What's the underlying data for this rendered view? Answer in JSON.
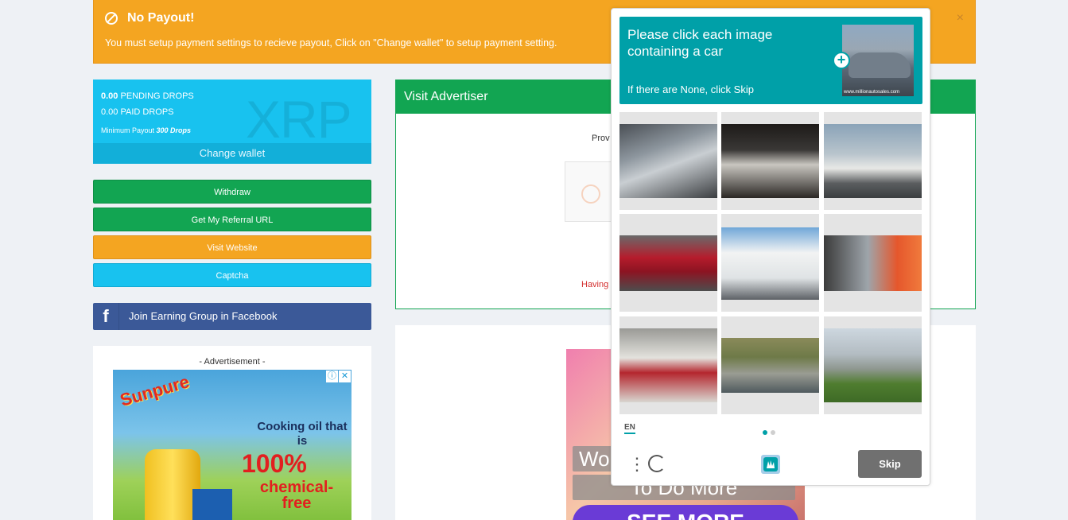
{
  "alert": {
    "title": "No Payout!",
    "message": "You must setup payment settings to recieve payout, Click on \"Change wallet\" to setup payment setting.",
    "close": "×"
  },
  "wallet": {
    "pending_value": "0.00",
    "pending_label": " PENDING DROPS",
    "paid_value": "0.00",
    "paid_label": " PAID DROPS",
    "min_label": "Minimum Payout ",
    "min_value": "300 Drops",
    "watermark": "XRP",
    "change_wallet": "Change wallet"
  },
  "sidebar": {
    "withdraw": "Withdraw",
    "referral": "Get My Referral URL",
    "visit": "Visit Website",
    "captcha": "Captcha",
    "facebook": "Join Earning Group in Facebook"
  },
  "ads": {
    "label": "- Advertisement -",
    "left": {
      "brand": "Sunpure",
      "line1": "Cooking oil that is",
      "line2": "100%",
      "line3": "chemical-free"
    },
    "right": {
      "line1": "Wo",
      "line2": "To Do More",
      "line3": "SEE MORE"
    }
  },
  "visit_panel": {
    "title": "Visit Advertiser",
    "provide": "Prov",
    "having": "Having"
  },
  "captcha": {
    "prompt": "Please click each image containing a car",
    "sub": "If there are None, click Skip",
    "example_url": "www.millionautosales.com",
    "lang": "EN",
    "skip": "Skip"
  },
  "colors": {
    "green": "#12a552",
    "orange": "#f4a521",
    "cyan": "#18c2ef",
    "facebook": "#3b5998",
    "hcaptcha_teal": "#00a0a8"
  }
}
